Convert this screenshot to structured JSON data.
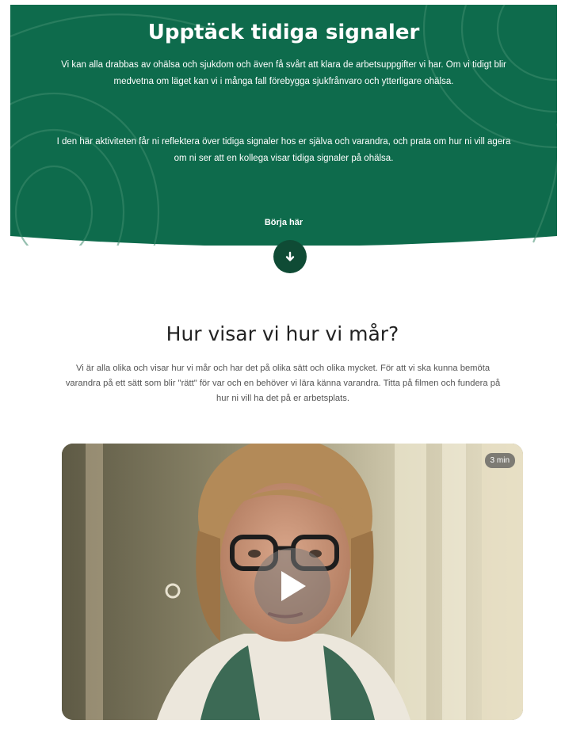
{
  "hero": {
    "title": "Upptäck tidiga signaler",
    "paragraph_1": "Vi kan alla drabbas av ohälsa och sjukdom och även få svårt att klara de arbetsuppgifter vi har. Om vi tidigt blir medvetna om läget kan vi i många fall förebygga sjukfrånvaro och ytterligare ohälsa.",
    "paragraph_2": "I den här aktiviteten får ni reflektera över tidiga signaler hos er själva och varandra, och prata om hur ni vill agera om ni ser att en kollega visar tidiga signaler på ohälsa.",
    "start_label": "Börja här",
    "start_icon": "arrow-down-icon",
    "background_color": "#0e6b4c",
    "button_color": "#0f4b35"
  },
  "section": {
    "title": "Hur visar vi hur vi mår?",
    "body": "Vi är alla olika och visar hur vi mår och har det på olika sätt och olika mycket. För att vi ska kunna bemöta varandra på ett sätt som blir \"rätt\" för var och en behöver vi lära känna varandra. Titta på filmen och fundera på hur ni vill ha det på er arbetsplats."
  },
  "video": {
    "duration": "3 min",
    "play_icon": "play-icon"
  }
}
